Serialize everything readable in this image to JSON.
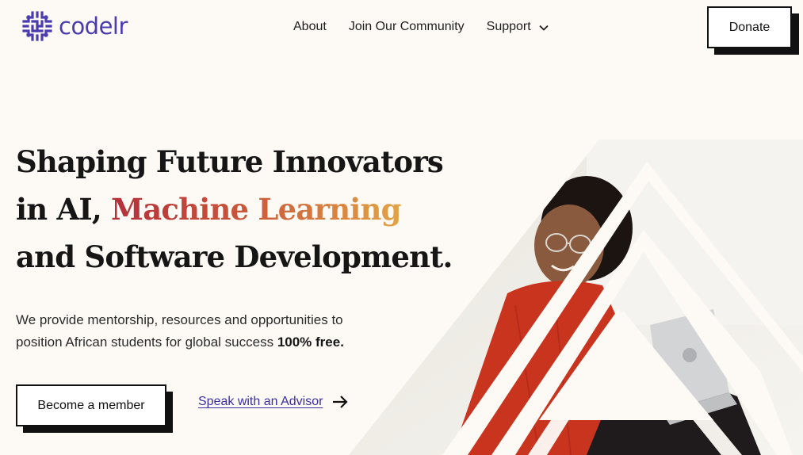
{
  "brand": {
    "name": "codelr",
    "logo_icon": "maze-logo-icon",
    "color": "#4a3cae"
  },
  "nav": {
    "items": [
      {
        "label": "About"
      },
      {
        "label": "Join Our Community"
      },
      {
        "label": "Support",
        "icon": "chevron-down-icon"
      }
    ],
    "donate_label": "Donate"
  },
  "hero": {
    "headline_before": "Shaping Future Innovators in AI,",
    "headline_highlight": "Machine Learning",
    "headline_after": "and Software Development.",
    "highlight_colors": [
      "#b52f3a",
      "#e2a445"
    ],
    "subtext": "We provide mentorship, resources and opportunities to position African students for global success",
    "subtext_emphasis": "100% free.",
    "primary_button": "Become a member",
    "secondary_link": "Speak with an Advisor",
    "secondary_icon": "arrow-right-icon",
    "image": "student-with-laptop-photo"
  },
  "colors": {
    "background": "#fdfaf6",
    "text": "#161616",
    "link": "#3b2fa2"
  }
}
